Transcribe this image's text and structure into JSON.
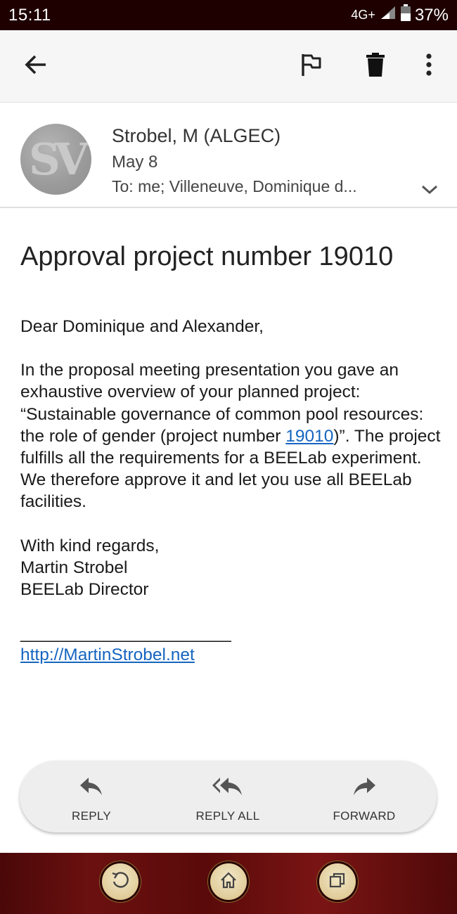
{
  "status_bar": {
    "time": "15:11",
    "network": "4G+",
    "battery": "37%"
  },
  "toolbar": {
    "back_icon": "arrow-left-icon",
    "flag_icon": "flag-icon",
    "delete_icon": "trash-icon",
    "more_icon": "more-vert-icon"
  },
  "sender": {
    "avatar_initials": "SV",
    "name": "Strobel, M (ALGEC)",
    "date": "May 8",
    "to": "To: me; Villeneuve, Dominique d..."
  },
  "email": {
    "subject": "Approval project number 19010",
    "greeting": "Dear Dominique and Alexander,",
    "para1_before": "In the proposal meeting presentation you gave an exhaustive overview of your planned project:  “Sustainable governance of common pool resources: the role of gender (project number ",
    "para1_link": "19010",
    "para1_after": ")”. The project fulfills all the requirements for a BEELab experiment. We therefore approve it and let you use all BEELab facilities.",
    "closing": "With kind regards,",
    "signature_name": "Martin Strobel",
    "signature_title": "BEELab Director",
    "separator": "______________________",
    "website": "http://MartinStrobel.net"
  },
  "actions": {
    "reply": "REPLY",
    "reply_all": "REPLY ALL",
    "forward": "FORWARD"
  },
  "colors": {
    "link": "#1565c0",
    "status_bar_bg": "#1e0000",
    "nav_bar_bg": "#5a0a0a"
  }
}
